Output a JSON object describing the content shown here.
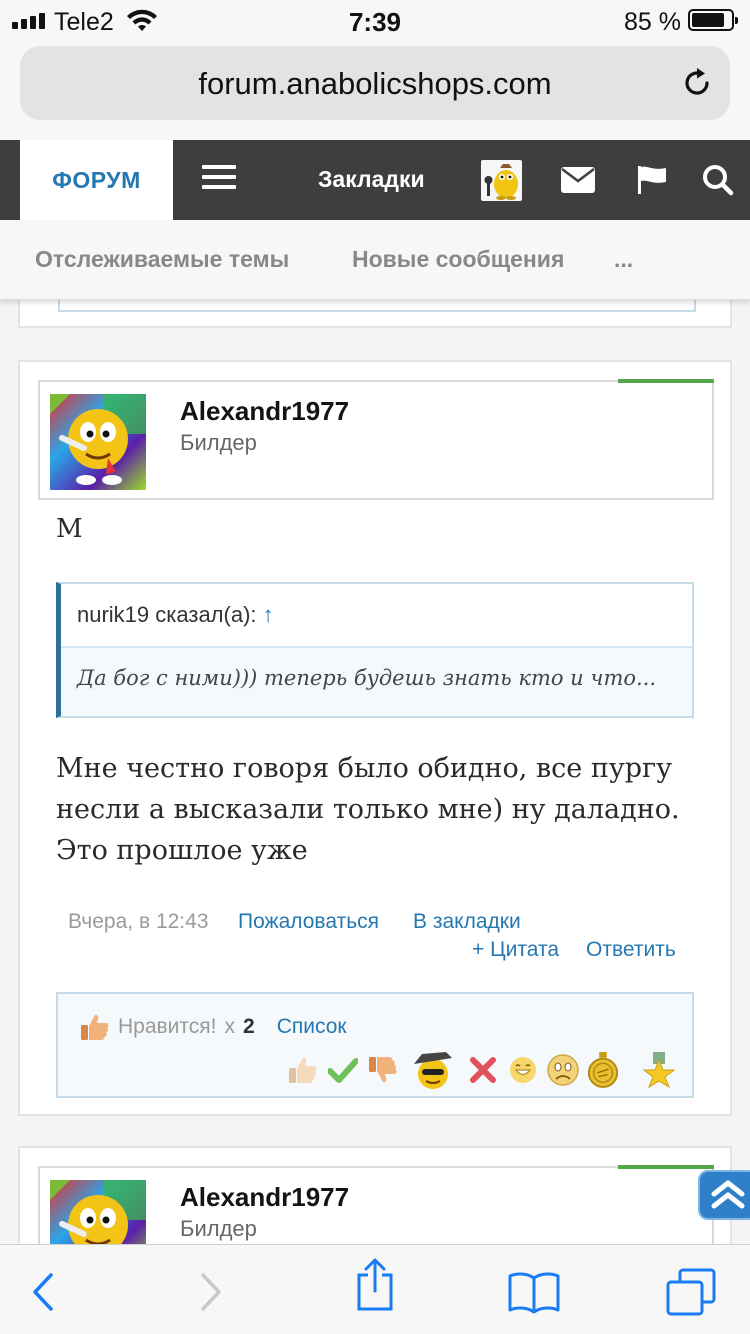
{
  "status_bar": {
    "carrier": "Tele2",
    "time": "7:39",
    "battery_percent_label": "85 %",
    "battery_level": 0.85
  },
  "browser": {
    "url": "forum.anabolicshops.com"
  },
  "forum_nav": {
    "forum_tab": "ФОРУМ",
    "bookmarks": "Закладки"
  },
  "sub_nav": {
    "watched_threads": "Отслеживаемые темы",
    "new_posts": "Новые сообщения",
    "more": "..."
  },
  "posts": [
    {
      "username": "Alexandr1977",
      "user_title": "Билдер",
      "text_first": "М",
      "quote": {
        "author_line": "nurik19 сказал(а):",
        "arrow": "↑",
        "text": "Да бог с ними))) теперь будешь знать кто и что..."
      },
      "text_main": "Мне честно говоря было обидно, все пургу несли а высказали только мне) ну даладно. Это прошлое уже",
      "date": "Вчера, в 12:43",
      "actions": {
        "report": "Пожаловаться",
        "bookmark": "В закладки",
        "quote": "+ Цитата",
        "reply": "Ответить"
      },
      "likes": {
        "label": "Нравится!",
        "multiplier": "x",
        "count": "2",
        "list": "Список"
      }
    },
    {
      "username": "Alexandr1977",
      "user_title": "Билдер"
    }
  ],
  "colors": {
    "link": "#2577b1",
    "nav_bg": "#3e3e3e",
    "online": "#7cbb3a",
    "scroll_top": "#2f80c9"
  },
  "icons": {
    "reload": "reload-icon",
    "menu": "hamburger-icon",
    "messages": "envelope-icon",
    "alerts": "flag-icon",
    "search": "search-icon",
    "back": "back-chevron-icon",
    "forward": "forward-chevron-icon",
    "share": "share-icon",
    "bookmarks": "book-icon",
    "tabs": "tabs-icon",
    "scroll_top": "double-chevron-up-icon"
  }
}
